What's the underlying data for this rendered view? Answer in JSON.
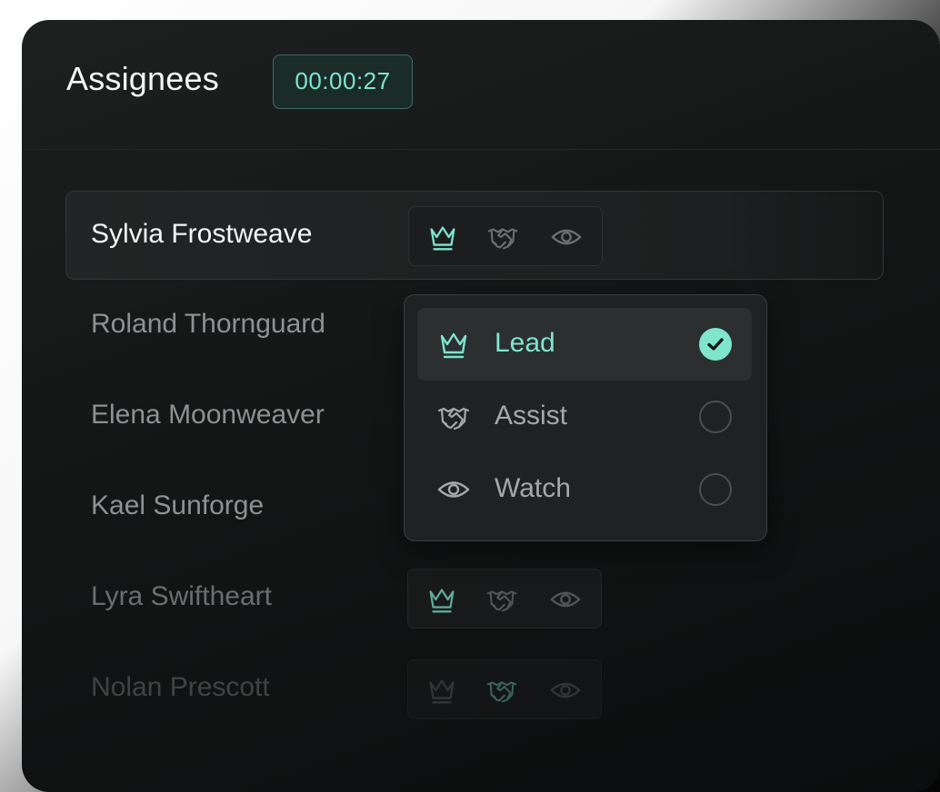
{
  "header": {
    "title": "Assignees",
    "timer": "00:00:27"
  },
  "assignees": [
    {
      "name": "Sylvia Frostweave",
      "selected": true,
      "roles_visible": true,
      "active_role": "lead"
    },
    {
      "name": "Roland Thornguard",
      "selected": false,
      "roles_visible": false
    },
    {
      "name": "Elena Moonweaver",
      "selected": false,
      "roles_visible": false
    },
    {
      "name": "Kael Sunforge",
      "selected": false,
      "roles_visible": false
    },
    {
      "name": "Lyra Swiftheart",
      "selected": false,
      "roles_visible": true,
      "active_role": "lead"
    },
    {
      "name": "Nolan Prescott",
      "selected": false,
      "roles_visible": true,
      "active_role": "assist"
    }
  ],
  "role_menu": {
    "options": [
      {
        "label": "Lead",
        "icon": "crown-icon",
        "checked": true
      },
      {
        "label": "Assist",
        "icon": "handshake-icon",
        "checked": false
      },
      {
        "label": "Watch",
        "icon": "eye-icon",
        "checked": false
      }
    ]
  },
  "colors": {
    "accent": "#7fe5cd",
    "muted_icon": "#6a6f71",
    "panel_bg": "#141616"
  }
}
